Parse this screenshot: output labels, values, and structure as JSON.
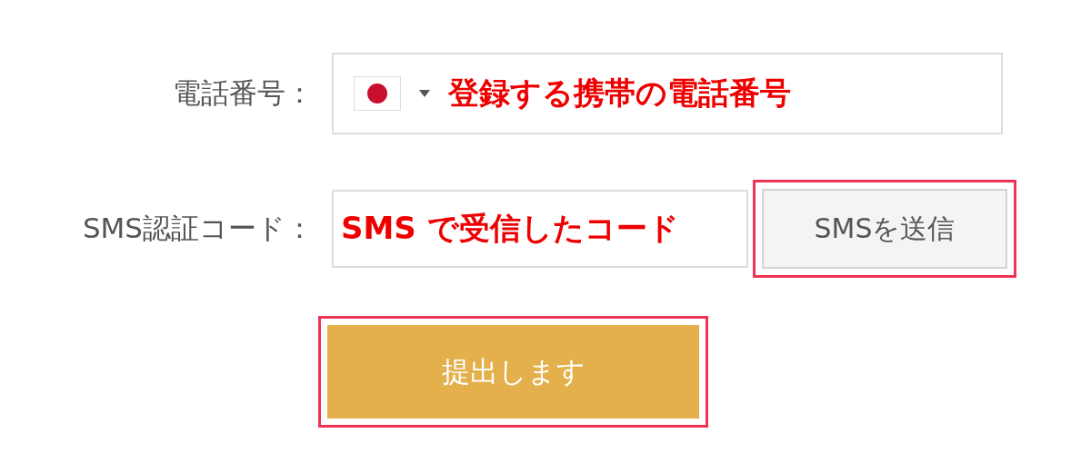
{
  "phone": {
    "label": "電話番号：",
    "value": "登録する携帯の電話番号"
  },
  "sms_code": {
    "label": "SMS認証コード：",
    "value": "SMS で受信したコード"
  },
  "send_button": {
    "label": "SMSを送信",
    "highlighted": true
  },
  "submit_button": {
    "label": "提出します",
    "highlighted": true
  }
}
